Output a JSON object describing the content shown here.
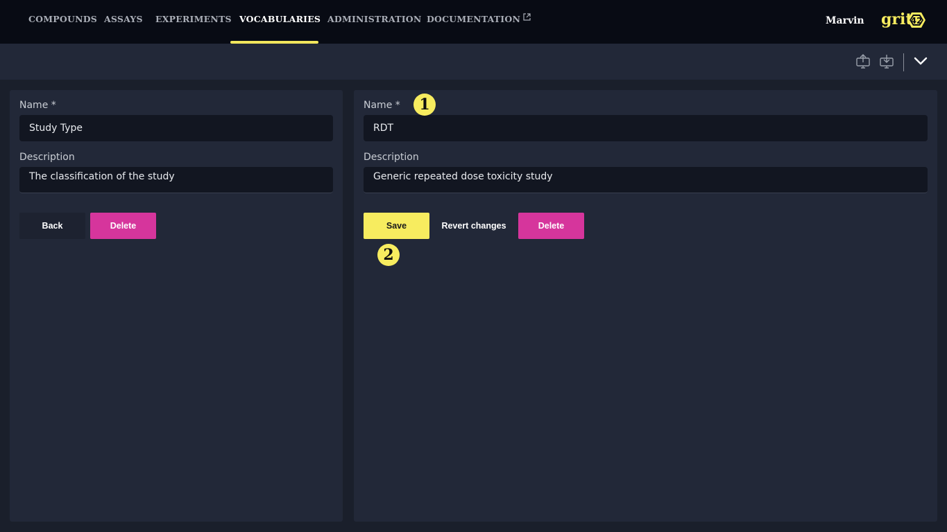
{
  "nav": {
    "items": [
      "COMPOUNDS",
      "ASSAYS",
      "EXPERIMENTS",
      "VOCABULARIES",
      "ADMINISTRATION",
      "DOCUMENTATION"
    ],
    "active": "VOCABULARIES",
    "user": "Marvin",
    "logo_text": "grit",
    "logo_number": "42"
  },
  "toolbar": {
    "icons": [
      "upload-icon",
      "download-icon",
      "chevron-down-icon"
    ]
  },
  "vocabulary": {
    "name_label": "Name *",
    "name_value": "Study Type",
    "description_label": "Description",
    "description_value": "The classification of the study",
    "back_label": "Back",
    "delete_label": "Delete"
  },
  "item": {
    "name_label": "Name *",
    "name_value": "RDT",
    "description_label": "Description",
    "description_value": "Generic repeated dose toxicity study",
    "save_label": "Save",
    "revert_label": "Revert changes",
    "delete_label": "Delete"
  },
  "annotations": {
    "badge_1": "1",
    "badge_2": "2"
  },
  "colors": {
    "accent_yellow": "#f7ec5f",
    "delete_magenta": "#d6359c",
    "background": "#1a1f2b",
    "panel": "#222838",
    "topbar": "#080b14"
  }
}
